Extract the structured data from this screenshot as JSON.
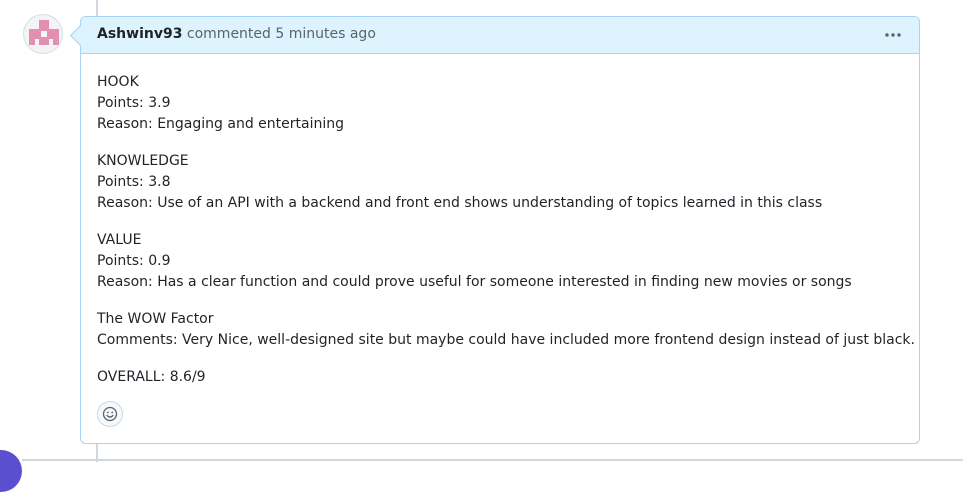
{
  "comment": {
    "author": "Ashwinv93",
    "action": "commented",
    "time": "5 minutes ago",
    "sections": [
      {
        "title": "HOOK",
        "points": "Points: 3.9",
        "reason": "Reason: Engaging and entertaining"
      },
      {
        "title": "KNOWLEDGE",
        "points": "Points: 3.8",
        "reason": "Reason: Use of an API with a backend and front end shows understanding of topics learned in this class"
      },
      {
        "title": "VALUE",
        "points": "Points: 0.9",
        "reason": "Reason: Has a clear function and could prove useful for someone interested in finding new movies or songs"
      }
    ],
    "wow_title": "The WOW Factor",
    "wow_comments": "Comments: Very Nice, well-designed site but maybe could have included more frontend design instead of just black.",
    "overall": "OVERALL: 8.6/9"
  },
  "icons": {
    "more": "kebab-horizontal-icon",
    "reaction": "smiley-icon",
    "avatar": "identicon"
  },
  "colors": {
    "header_bg": "#ddf4ff",
    "border": "#a9d4f5",
    "identicon": "#e38fb0"
  }
}
